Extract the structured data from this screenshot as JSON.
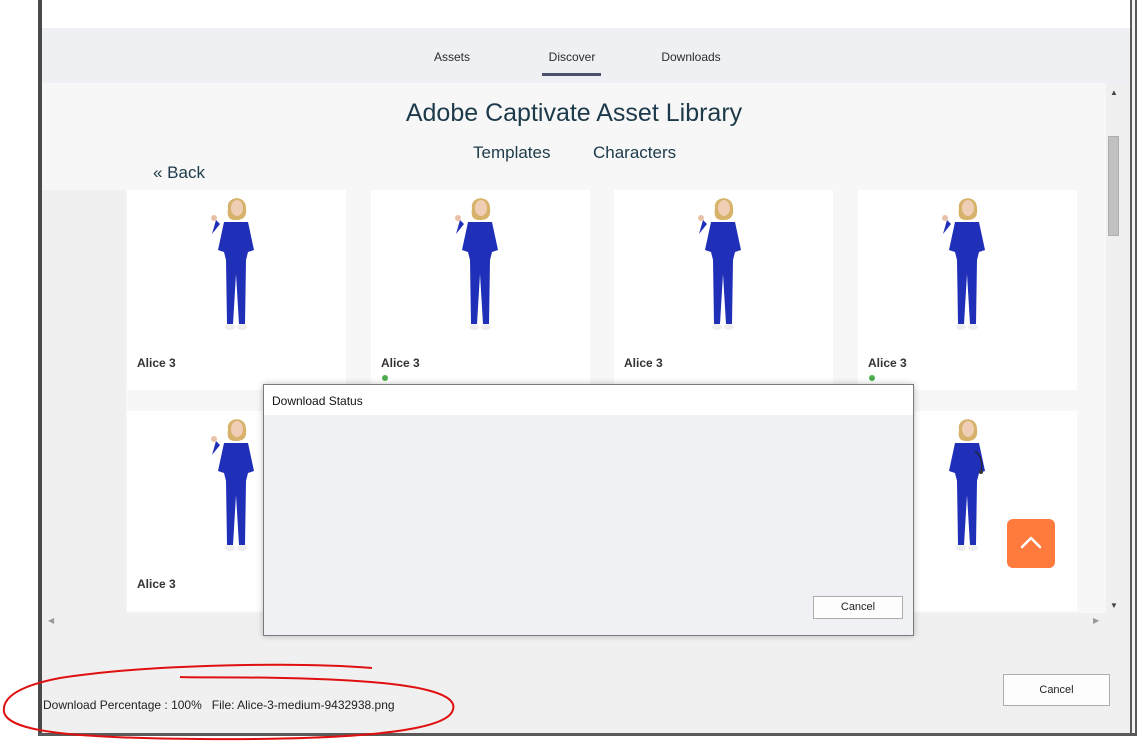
{
  "tabs": [
    {
      "label": "Assets",
      "active": false
    },
    {
      "label": "Discover",
      "active": true
    },
    {
      "label": "Downloads",
      "active": false
    }
  ],
  "library": {
    "title": "Adobe Captivate Asset Library",
    "subnav": [
      "Templates",
      "Characters"
    ],
    "back_label": "« Back"
  },
  "cards": [
    {
      "name": "Alice 3",
      "downloaded": false,
      "pose": "hand-raised"
    },
    {
      "name": "Alice 3",
      "downloaded": true,
      "pose": "hand-raised"
    },
    {
      "name": "Alice 3",
      "downloaded": false,
      "pose": "hand-raised"
    },
    {
      "name": "Alice 3",
      "downloaded": true,
      "pose": "hand-raised"
    },
    {
      "name": "Alice 3",
      "downloaded": false,
      "pose": "hand-raised"
    },
    {
      "name": "",
      "downloaded": false,
      "pose": "stethoscope"
    }
  ],
  "dialog": {
    "title": "Download Status",
    "cancel_label": "Cancel"
  },
  "status": {
    "percentage_text": "Download Percentage : 100%",
    "file_text": "File: Alice-3-medium-9432938.png"
  },
  "window": {
    "cancel_label": "Cancel"
  },
  "icons": {
    "scroll_top": "chevron-up-icon"
  },
  "colors": {
    "accent_tab": "#4a4f6b",
    "fab": "#ff7a3d",
    "downloaded_dot": "#4cae4c",
    "scrubs": "#1f2fb8",
    "annotation": "#e01010"
  }
}
